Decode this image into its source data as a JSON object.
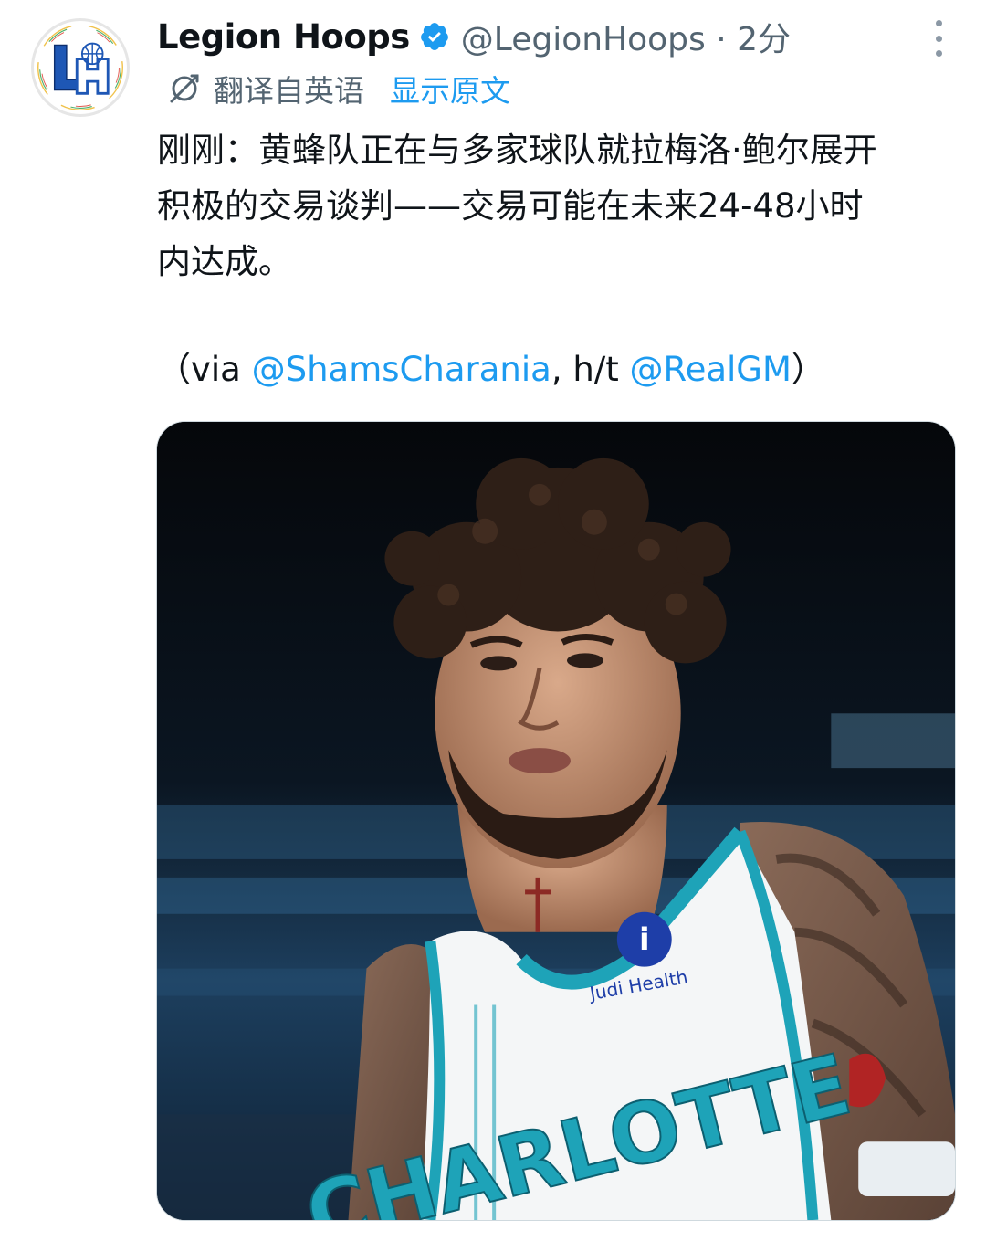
{
  "author": {
    "display_name": "Legion Hoops",
    "handle": "@LegionHoops",
    "separator": "·",
    "time": "2分",
    "avatar_letters": "LH"
  },
  "translation": {
    "label": "翻译自英语",
    "show_original": "显示原文"
  },
  "tweet": {
    "lines": [
      "刚刚：黄蜂队正在与多家球队就拉梅洛·鲍尔展开",
      "积极的交易谈判——交易可能在未来24-48小时",
      "内达成。"
    ],
    "credit_open": "（via ",
    "mention_1": "@ShamsCharania",
    "credit_mid": ", h/t ",
    "mention_2": "@RealGM",
    "credit_close": "）"
  },
  "media": {
    "jersey_text": "CHARLOTTE",
    "sponsor_text": "Judi Health"
  },
  "colors": {
    "accent": "#1d9bf0",
    "text": "#0f1419",
    "secondary": "#536471",
    "jersey_teal": "#1ea3b8"
  },
  "icons": {
    "verified": "verified-badge-icon",
    "translate": "translate-icon",
    "more": "more-options-icon"
  }
}
